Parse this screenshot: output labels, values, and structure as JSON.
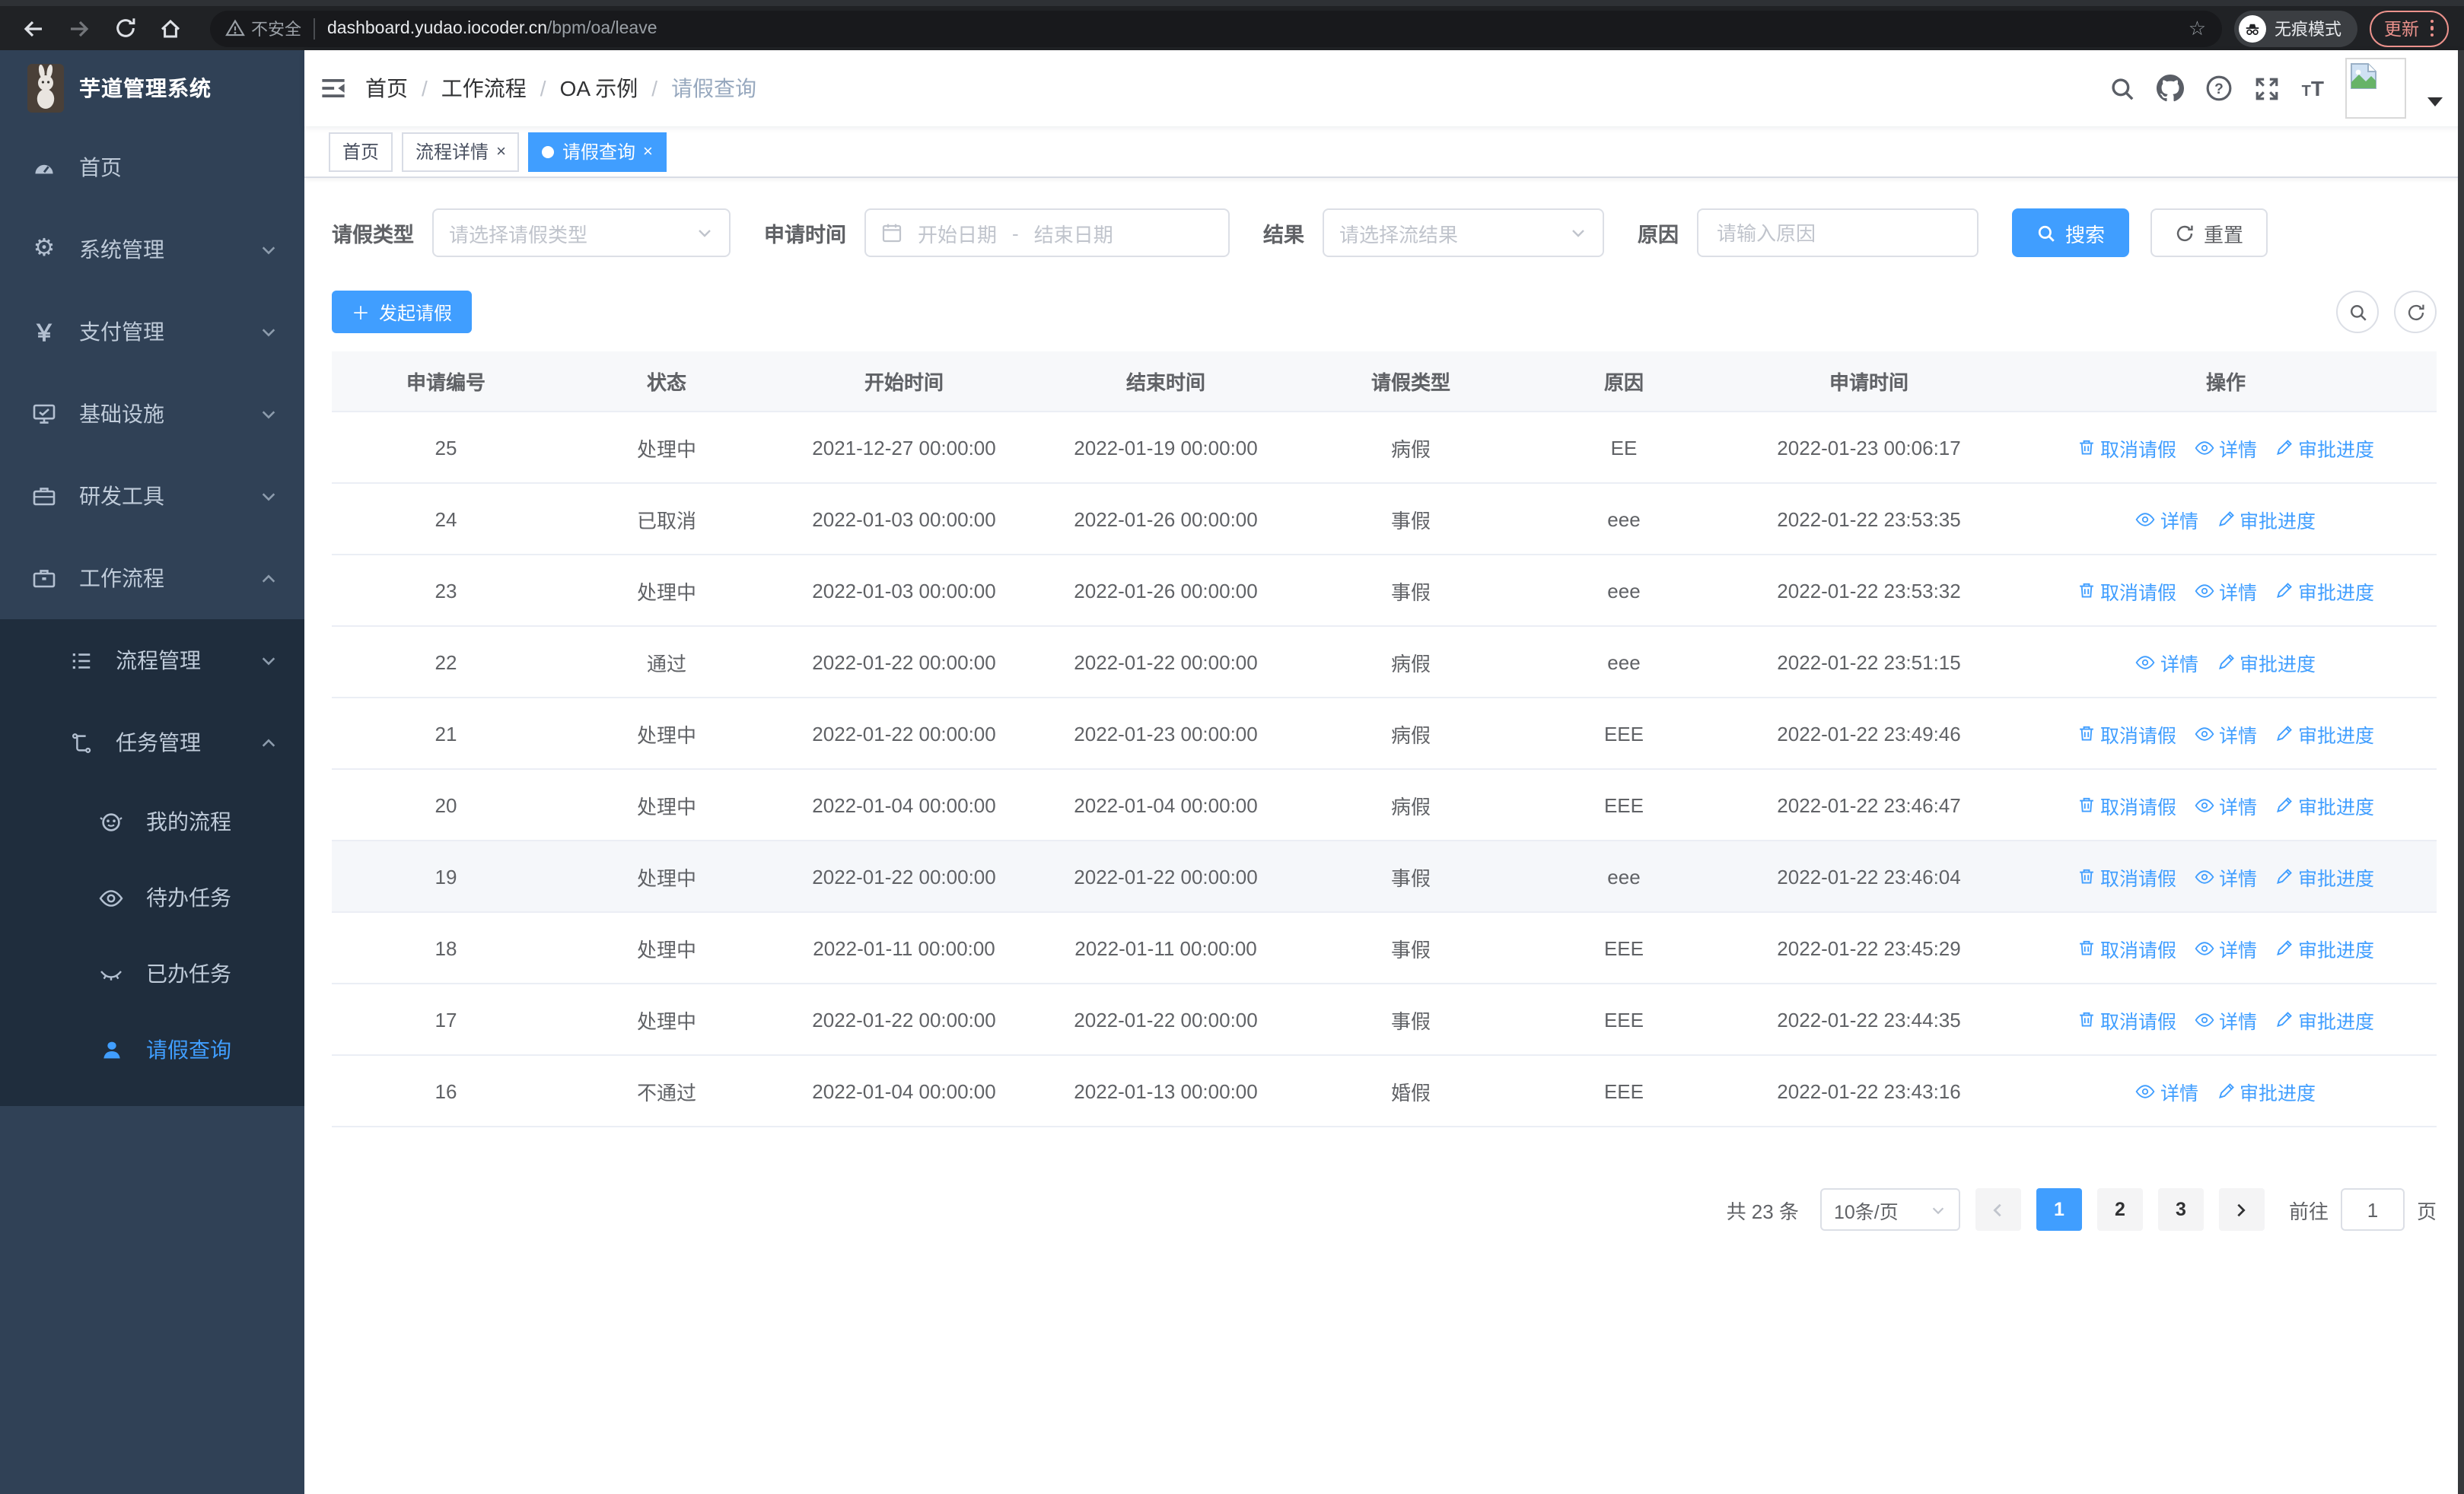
{
  "browser": {
    "security_label": "不安全",
    "url_host": "dashboard.yudao.iocoder.cn",
    "url_path": "/bpm/oa/leave",
    "incognito_label": "无痕模式",
    "update_label": "更新"
  },
  "sidebar": {
    "app_title": "芋道管理系统",
    "menu": [
      {
        "label": "首页",
        "icon": "dashboard-icon"
      },
      {
        "label": "系统管理",
        "icon": "gear-icon"
      },
      {
        "label": "支付管理",
        "icon": "yen-icon"
      },
      {
        "label": "基础设施",
        "icon": "monitor-icon"
      },
      {
        "label": "研发工具",
        "icon": "toolbox-icon"
      },
      {
        "label": "工作流程",
        "icon": "briefcase-icon",
        "children": [
          {
            "label": "流程管理",
            "icon": "list-icon"
          },
          {
            "label": "任务管理",
            "icon": "flow-icon",
            "children": [
              {
                "label": "我的流程",
                "icon": "robot-icon"
              },
              {
                "label": "待办任务",
                "icon": "eye-icon"
              },
              {
                "label": "已办任务",
                "icon": "eye-closed-icon"
              },
              {
                "label": "请假查询",
                "icon": "user-icon",
                "active": true
              }
            ]
          }
        ]
      }
    ]
  },
  "header": {
    "breadcrumb": [
      "首页",
      "工作流程",
      "OA 示例",
      "请假查询"
    ]
  },
  "tabs": [
    {
      "label": "首页"
    },
    {
      "label": "流程详情",
      "closable": true
    },
    {
      "label": "请假查询",
      "closable": true,
      "active": true
    }
  ],
  "filters": {
    "leave_type_label": "请假类型",
    "leave_type_placeholder": "请选择请假类型",
    "apply_time_label": "申请时间",
    "start_placeholder": "开始日期",
    "range_separator": "-",
    "end_placeholder": "结束日期",
    "result_label": "结果",
    "result_placeholder": "请选择流结果",
    "reason_label": "原因",
    "reason_placeholder": "请输入原因",
    "search_label": "搜索",
    "reset_label": "重置"
  },
  "toolbar": {
    "create_label": "发起请假"
  },
  "table": {
    "columns": [
      "申请编号",
      "状态",
      "开始时间",
      "结束时间",
      "请假类型",
      "原因",
      "申请时间",
      "操作"
    ],
    "action_labels": {
      "cancel": "取消请假",
      "detail": "详情",
      "progress": "审批进度"
    },
    "rows": [
      {
        "id": "25",
        "status": "处理中",
        "start": "2021-12-27 00:00:00",
        "end": "2022-01-19 00:00:00",
        "type": "病假",
        "reason": "EE",
        "applied": "2022-01-23 00:06:17",
        "actions": [
          "cancel",
          "detail",
          "progress"
        ],
        "highlighted": false
      },
      {
        "id": "24",
        "status": "已取消",
        "start": "2022-01-03 00:00:00",
        "end": "2022-01-26 00:00:00",
        "type": "事假",
        "reason": "eee",
        "applied": "2022-01-22 23:53:35",
        "actions": [
          "detail",
          "progress"
        ],
        "highlighted": false
      },
      {
        "id": "23",
        "status": "处理中",
        "start": "2022-01-03 00:00:00",
        "end": "2022-01-26 00:00:00",
        "type": "事假",
        "reason": "eee",
        "applied": "2022-01-22 23:53:32",
        "actions": [
          "cancel",
          "detail",
          "progress"
        ],
        "highlighted": false
      },
      {
        "id": "22",
        "status": "通过",
        "start": "2022-01-22 00:00:00",
        "end": "2022-01-22 00:00:00",
        "type": "病假",
        "reason": "eee",
        "applied": "2022-01-22 23:51:15",
        "actions": [
          "detail",
          "progress"
        ],
        "highlighted": false
      },
      {
        "id": "21",
        "status": "处理中",
        "start": "2022-01-22 00:00:00",
        "end": "2022-01-23 00:00:00",
        "type": "病假",
        "reason": "EEE",
        "applied": "2022-01-22 23:49:46",
        "actions": [
          "cancel",
          "detail",
          "progress"
        ],
        "highlighted": false
      },
      {
        "id": "20",
        "status": "处理中",
        "start": "2022-01-04 00:00:00",
        "end": "2022-01-04 00:00:00",
        "type": "病假",
        "reason": "EEE",
        "applied": "2022-01-22 23:46:47",
        "actions": [
          "cancel",
          "detail",
          "progress"
        ],
        "highlighted": false
      },
      {
        "id": "19",
        "status": "处理中",
        "start": "2022-01-22 00:00:00",
        "end": "2022-01-22 00:00:00",
        "type": "事假",
        "reason": "eee",
        "applied": "2022-01-22 23:46:04",
        "actions": [
          "cancel",
          "detail",
          "progress"
        ],
        "highlighted": true
      },
      {
        "id": "18",
        "status": "处理中",
        "start": "2022-01-11 00:00:00",
        "end": "2022-01-11 00:00:00",
        "type": "事假",
        "reason": "EEE",
        "applied": "2022-01-22 23:45:29",
        "actions": [
          "cancel",
          "detail",
          "progress"
        ],
        "highlighted": false
      },
      {
        "id": "17",
        "status": "处理中",
        "start": "2022-01-22 00:00:00",
        "end": "2022-01-22 00:00:00",
        "type": "事假",
        "reason": "EEE",
        "applied": "2022-01-22 23:44:35",
        "actions": [
          "cancel",
          "detail",
          "progress"
        ],
        "highlighted": false
      },
      {
        "id": "16",
        "status": "不通过",
        "start": "2022-01-04 00:00:00",
        "end": "2022-01-13 00:00:00",
        "type": "婚假",
        "reason": "EEE",
        "applied": "2022-01-22 23:43:16",
        "actions": [
          "detail",
          "progress"
        ],
        "highlighted": false
      }
    ]
  },
  "pagination": {
    "total_text": "共 23 条",
    "page_size": "10条/页",
    "pages": [
      {
        "label": "1",
        "active": true
      },
      {
        "label": "2",
        "active": false
      },
      {
        "label": "3",
        "active": false
      }
    ],
    "goto_label": "前往",
    "goto_value": "1",
    "page_unit": "页"
  },
  "colors": {
    "accent": "#409eff",
    "sidebar_bg": "#304156",
    "submenu_bg": "#1f2d3d",
    "update_badge": "#ec928c"
  }
}
